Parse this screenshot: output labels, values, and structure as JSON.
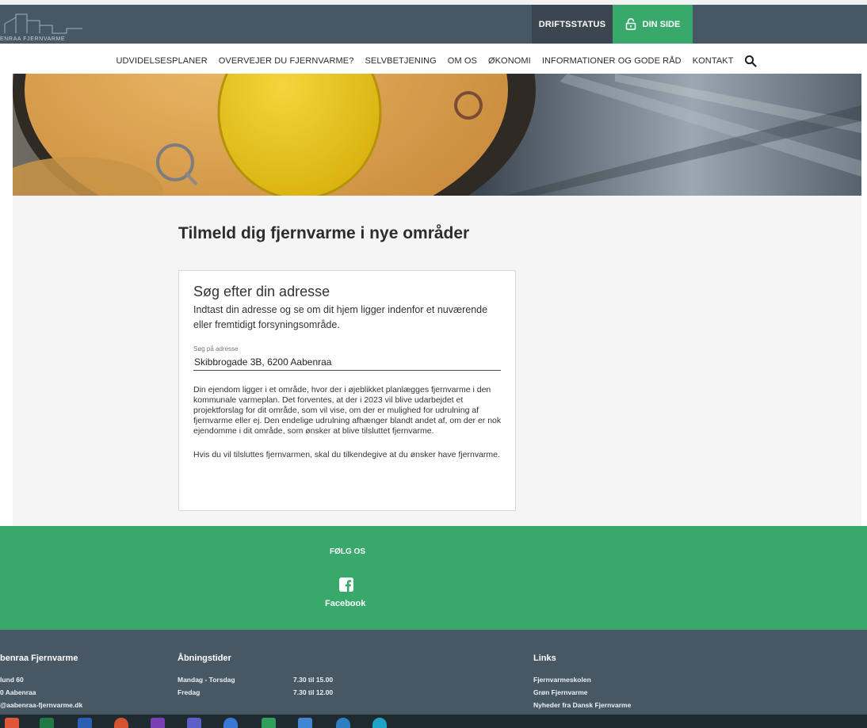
{
  "header": {
    "logo_text": "ENRAA FJERNVARME",
    "drift_label": "DRIFTSSTATUS",
    "din_side_label": "DIN SIDE"
  },
  "nav": {
    "items": [
      "UDVIDELSESPLANER",
      "OVERVEJER DU FJERNVARME?",
      "SELVBETJENING",
      "OM OS",
      "ØKONOMI",
      "INFORMATIONER OG GODE RÅD",
      "KONTAKT"
    ]
  },
  "main": {
    "title": "Tilmeld dig fjernvarme i nye områder",
    "card": {
      "title": "Søg efter din adresse",
      "intro": "Indtast din adresse og se om dit hjem ligger indenfor et nuværende eller fremtidigt forsyningsområde.",
      "field_label": "Søg på adresse",
      "field_value": "Skibbrogade 3B, 6200 Aabenraa",
      "result_1": "Din ejendom ligger i et område, hvor der i øjeblikket planlægges fjernvarme i den kommunale varmeplan. Det forventes, at der i 2023 vil blive udarbejdet et projektforslag for dit område, som vil vise, om der er mulighed for udrulning af fjernvarme eller ej. Den endelige udrulning afhænger blandt andet af, om der er nok ejendomme i dit område, som ønsker at blive tilsluttet fjernvarme.",
      "result_2": "Hvis du vil tilsluttes fjernvarmen, skal du tilkendegive at du ønsker have fjernvarme."
    }
  },
  "follow": {
    "label": "FØLG OS",
    "facebook_label": "Facebook"
  },
  "footer": {
    "col1": {
      "heading": "benraa Fjernvarme",
      "lines": [
        "lund 60",
        "0 Aabenraa",
        "@aabenraa-fjernvarme.dk"
      ]
    },
    "col2": {
      "heading": "Åbningstider",
      "rows": [
        {
          "day": "Mandag - Torsdag",
          "time": "7.30 til 15.00"
        },
        {
          "day": "Fredag",
          "time": "7.30 til 12.00"
        }
      ]
    },
    "col3": {
      "heading": "Links",
      "links": [
        "Fjernvarmeskolen",
        "Grøn Fjernvarme",
        "Nyheder fra Dansk Fjernvarme"
      ]
    }
  },
  "colors": {
    "top_bar": "#485764",
    "green": "#38a96b",
    "drift_bg": "#3b4650"
  },
  "icons": {
    "search": "search-icon",
    "lock": "lock-icon",
    "facebook": "facebook-icon"
  }
}
